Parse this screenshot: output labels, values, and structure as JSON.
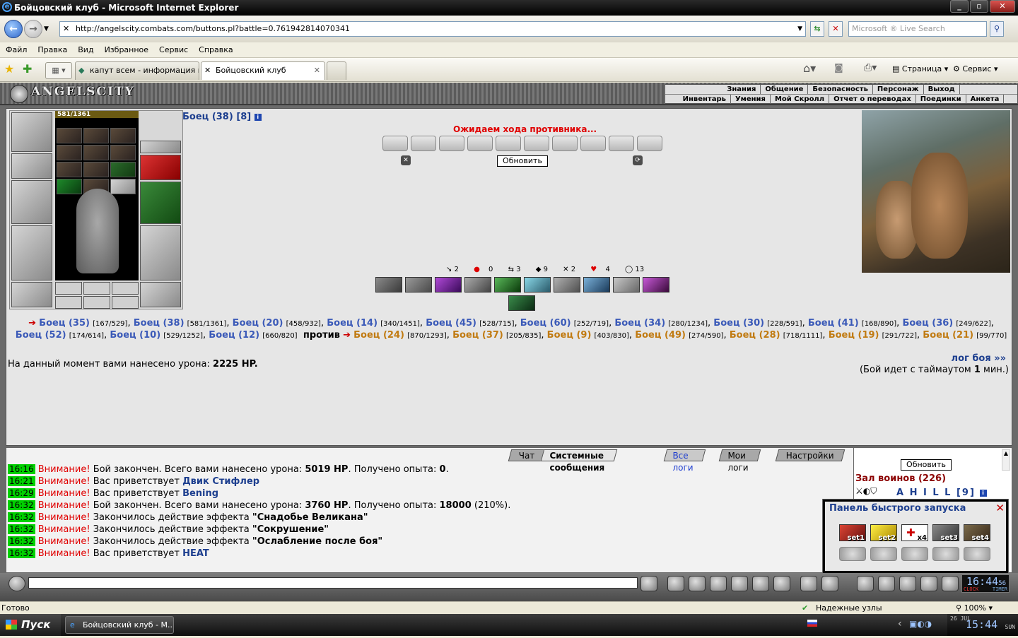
{
  "window": {
    "title": "Бойцовский клуб - Microsoft Internet Explorer"
  },
  "address": {
    "url": "http://angelscity.combats.com/buttons.pl?battle=0.761942814070341",
    "search_placeholder": "Microsoft ® Live Search"
  },
  "menu": [
    "Файл",
    "Правка",
    "Вид",
    "Избранное",
    "Сервис",
    "Справка"
  ],
  "tabs": [
    {
      "label": "капут всем - информация в ..."
    },
    {
      "label": "Бойцовский клуб"
    }
  ],
  "toolbar_right": {
    "page": "Страница",
    "service": "Сервис"
  },
  "game": {
    "logo": "ANGELSCITY",
    "top_menu_row1": [
      "Знания",
      "Общение",
      "Безопасность",
      "Персонаж",
      "Выход"
    ],
    "top_menu_row2": [
      "Инвентарь",
      "Умения",
      "Мой Скролл",
      "Отчет о переводах",
      "Поединки",
      "Анкета"
    ],
    "hp": "581/1361",
    "fighter_name": "Боец (38) [8]",
    "status": "Ожидаем хода противника...",
    "refresh": "Обновить",
    "counters": [
      "2",
      "0",
      "3",
      "9",
      "2",
      "4",
      "13"
    ],
    "team1": [
      {
        "name": "Боец (35)",
        "hp": "[167/529]"
      },
      {
        "name": "Боец (38)",
        "hp": "[581/1361]"
      },
      {
        "name": "Боец (20)",
        "hp": "[458/932]"
      },
      {
        "name": "Боец (14)",
        "hp": "[340/1451]"
      },
      {
        "name": "Боец (45)",
        "hp": "[528/715]"
      },
      {
        "name": "Боец (60)",
        "hp": "[252/719]"
      },
      {
        "name": "Боец (34)",
        "hp": "[280/1234]"
      },
      {
        "name": "Боец (30)",
        "hp": "[228/591]"
      },
      {
        "name": "Боец (41)",
        "hp": "[168/890]"
      },
      {
        "name": "Боец (36)",
        "hp": "[249/622]"
      },
      {
        "name": "Боец (52)",
        "hp": "[174/614]"
      },
      {
        "name": "Боец (10)",
        "hp": "[529/1252]"
      },
      {
        "name": "Боец (12)",
        "hp": "[660/820]"
      }
    ],
    "versus": "против",
    "team2": [
      {
        "name": "Боец (24)",
        "hp": "[870/1293]"
      },
      {
        "name": "Боец (37)",
        "hp": "[205/835]"
      },
      {
        "name": "Боец (9)",
        "hp": "[403/830]"
      },
      {
        "name": "Боец (49)",
        "hp": "[274/590]"
      },
      {
        "name": "Боец (28)",
        "hp": "[718/1111]"
      },
      {
        "name": "Боец (19)",
        "hp": "[291/722]"
      },
      {
        "name": "Боец (21)",
        "hp": "[99/770]"
      }
    ],
    "damage_label": "На данный момент вами нанесено урона:",
    "damage_value": "2225 HP.",
    "battle_log_link": "лог боя »»",
    "timeout_pre": "(Бой идет с таймаутом",
    "timeout_value": "1",
    "timeout_post": "мин.)"
  },
  "chat": {
    "tabs": [
      "Чат",
      "Системные сообщения",
      "Все логи",
      "Мои логи",
      "Настройки"
    ],
    "messages": [
      {
        "time": "16:16",
        "warn": "Внимание!",
        "text": "Бой закончен. Всего вами нанесено урона:",
        "bold1": "5019 HP",
        "text2": ". Получено опыта:",
        "bold2": "0",
        "text3": "."
      },
      {
        "time": "16:21",
        "warn": "Внимание!",
        "text": "Вас приветствует",
        "user": "Двик Стифлер"
      },
      {
        "time": "16:29",
        "warn": "Внимание!",
        "text": "Вас приветствует",
        "user": "Bening"
      },
      {
        "time": "16:32",
        "warn": "Внимание!",
        "text": "Бой закончен. Всего вами нанесено урона:",
        "bold1": "3760 HP",
        "text2": ". Получено опыта:",
        "bold2": "18000",
        "text3": "(210%)."
      },
      {
        "time": "16:32",
        "warn": "Внимание!",
        "text": "Закончилось действие эффекта",
        "quote": "\"Снадобье Великана\""
      },
      {
        "time": "16:32",
        "warn": "Внимание!",
        "text": "Закончилось действие эффекта",
        "quote": "\"Сокрушение\""
      },
      {
        "time": "16:32",
        "warn": "Внимание!",
        "text": "Закончилось действие эффекта",
        "quote": "\"Ослабление после боя\""
      },
      {
        "time": "16:32",
        "warn": "Внимание!",
        "text": "Вас приветствует",
        "user": "HEAT"
      }
    ],
    "refresh": "Обновить",
    "hall": "Зал воинов (226)",
    "online_user": "A H I L L [9]"
  },
  "quick_panel": {
    "title": "Панель быстрого запуска",
    "slots": [
      "set1",
      "set2",
      "x4",
      "set3",
      "set4"
    ]
  },
  "clock": {
    "time": "16:44",
    "sec": "56",
    "label1": "CLOCK",
    "label2": "TIMER"
  },
  "statusbar": {
    "left": "Готово",
    "zone": "Надежные узлы",
    "zoom": "100%"
  },
  "taskbar": {
    "start": "Пуск",
    "task": "Бойцовский клуб - М...",
    "time": "15:44",
    "day": "SUN",
    "date": "26 JUL"
  }
}
